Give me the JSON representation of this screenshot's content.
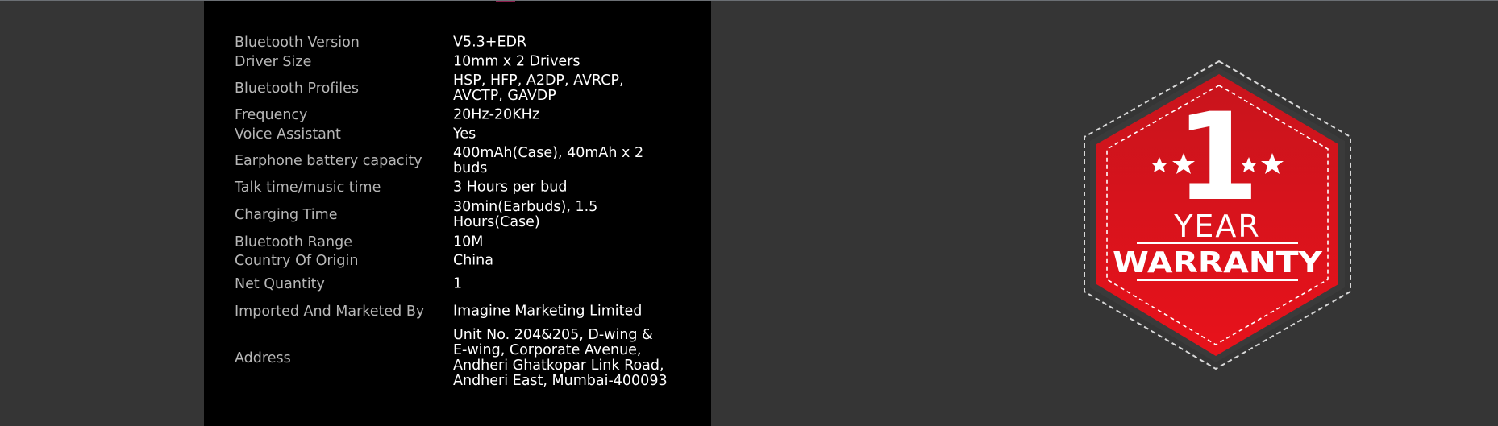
{
  "specs": [
    {
      "label": "Bluetooth Version",
      "value": "V5.3+EDR"
    },
    {
      "label": "Driver Size",
      "value": "10mm x 2 Drivers"
    },
    {
      "label": "Bluetooth Profiles",
      "value": "HSP, HFP, A2DP, AVRCP,\nAVCTP, GAVDP"
    },
    {
      "label": "Frequency",
      "value": "20Hz-20KHz"
    },
    {
      "label": "Voice Assistant",
      "value": "Yes"
    },
    {
      "label": "Earphone battery capacity",
      "value": "400mAh(Case), 40mAh x 2\nbuds"
    },
    {
      "label": "Talk time/music time",
      "value": "3 Hours per bud"
    },
    {
      "label": "Charging Time",
      "value": "30min(Earbuds), 1.5\nHours(Case)"
    },
    {
      "label": "Bluetooth Range",
      "value": "10M"
    },
    {
      "label": "Country Of Origin",
      "value": "China"
    },
    {
      "label": "Net Quantity",
      "value": "1"
    },
    {
      "label": "Imported And Marketed By",
      "value": "Imagine Marketing Limited"
    },
    {
      "label": "Address",
      "value": "Unit No. 204&205, D-wing &\nE-wing, Corporate Avenue,\nAndheri Ghatkopar Link Road,\nAndheri East, Mumbai-400093"
    }
  ],
  "badge": {
    "number": "1",
    "line1": "YEAR",
    "line2": "WARRANTY"
  },
  "colors": {
    "page_background": "#353535",
    "panel_background": "#000000",
    "label_text": "#b7b7b7",
    "value_text": "#ffffff",
    "badge_red": "#d4121c"
  }
}
